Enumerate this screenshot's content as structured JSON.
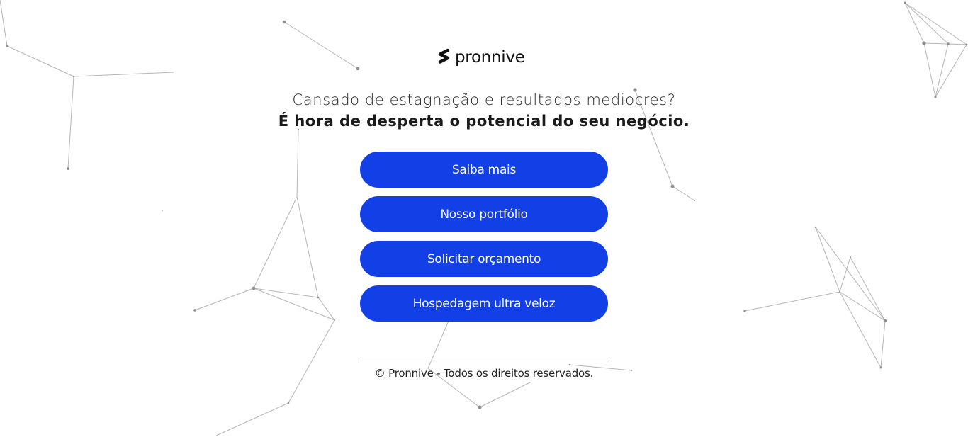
{
  "brand": {
    "name": "pronnive",
    "logo_icon": "pronnive-s-mark-icon"
  },
  "hero": {
    "line1": "Cansado de estagnação e resultados mediocres?",
    "line2": "É hora de desperta o potencial do seu negócio."
  },
  "buttons": [
    {
      "label": "Saiba mais"
    },
    {
      "label": "Nosso portfólio"
    },
    {
      "label": "Solicitar orçamento"
    },
    {
      "label": "Hospedagem ultra veloz"
    }
  ],
  "footer": {
    "text": "© Pronnive - Todos os direitos reservados."
  },
  "colors": {
    "button_bg": "#1340e6",
    "button_text": "#ffffff",
    "background": "#ffffff",
    "network_lines": "#9a9a9a"
  }
}
